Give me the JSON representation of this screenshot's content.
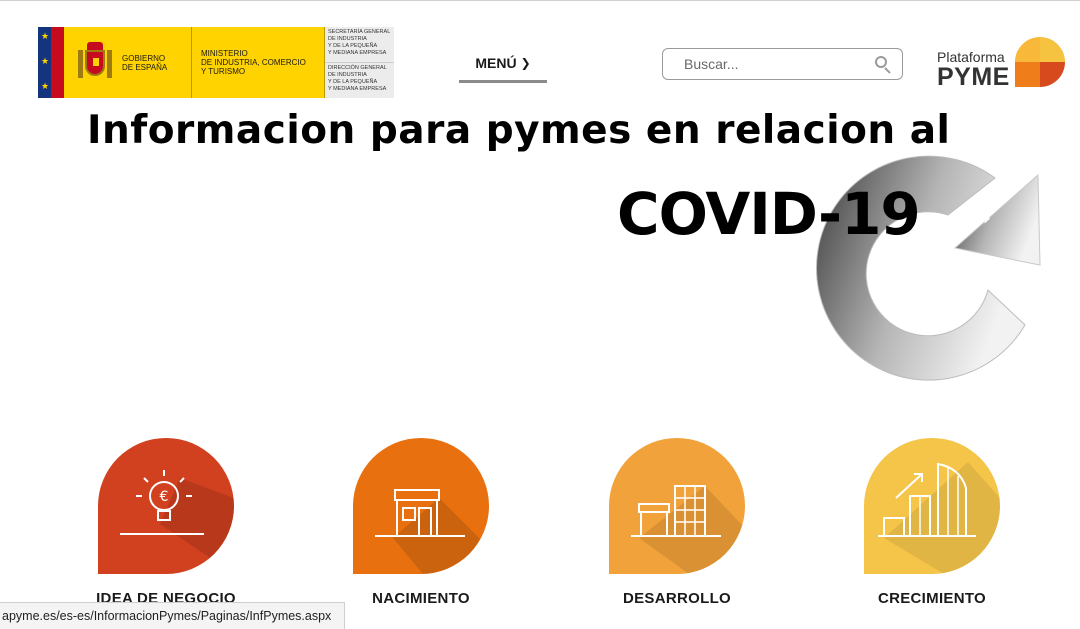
{
  "header": {
    "gov_logo": {
      "gobierno": [
        "GOBIERNO",
        "DE ESPAÑA"
      ],
      "ministerio": [
        "MINISTERIO",
        "DE INDUSTRIA, COMERCIO",
        "Y TURISMO"
      ],
      "secretaria": [
        "SECRETARÍA GENERAL",
        "DE INDUSTRIA",
        "Y DE LA PEQUEÑA",
        "Y MEDIANA EMPRESA"
      ],
      "direccion": [
        "DIRECCIÓN GENERAL",
        "DE INDUSTRIA",
        "Y DE LA PEQUEÑA",
        "Y MEDIANA EMPRESA"
      ]
    },
    "menu_label": "MENÚ",
    "search_placeholder": "Buscar...",
    "brand_small": "Plataforma",
    "brand_big": "PYME"
  },
  "hero": {
    "title": "Informacion para pymes en relacion al",
    "subtitle": "COVID-19",
    "next_icon": "chevron-right-icon"
  },
  "categories": [
    {
      "label": "IDEA DE NEGOCIO",
      "color": "#d1401f",
      "icon": "lightbulb-euro-icon"
    },
    {
      "label": "NACIMIENTO",
      "color": "#e8700f",
      "icon": "shop-icon"
    },
    {
      "label": "DESARROLLO",
      "color": "#f2a23a",
      "icon": "shop-building-icon"
    },
    {
      "label": "CRECIMIENTO",
      "color": "#f5c54a",
      "icon": "growth-buildings-icon"
    }
  ],
  "status_bar": {
    "url": "apyme.es/es-es/InformacionPymes/Paginas/InfPymes.aspx"
  },
  "colors": {
    "brand_orange": "#ef7d1a",
    "brand_yellow": "#f6c341",
    "brand_red": "#d64a1e"
  }
}
